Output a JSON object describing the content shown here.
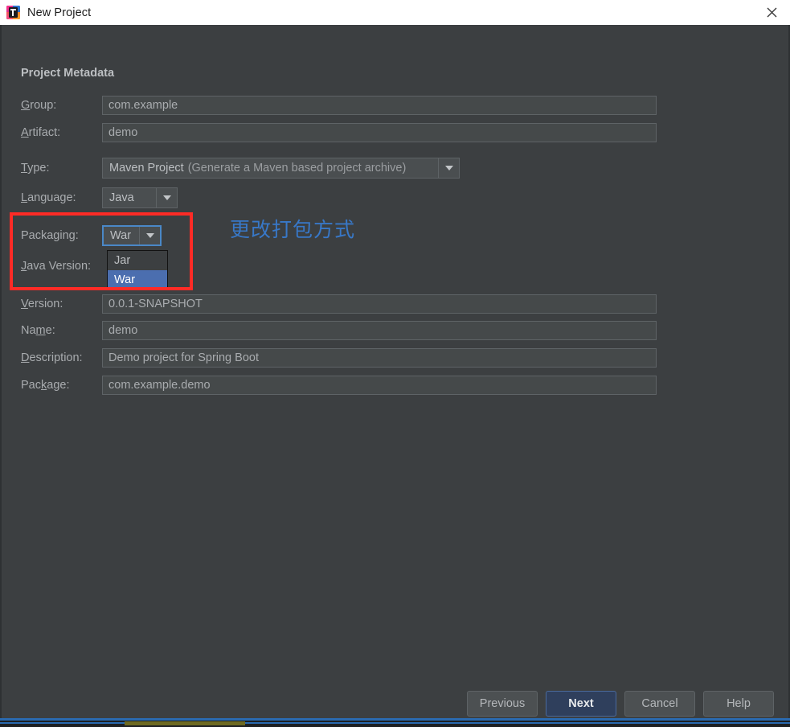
{
  "window": {
    "title": "New Project",
    "app_icon": "intellij-idea-icon",
    "close_icon": "close-icon"
  },
  "form": {
    "section_title": "Project Metadata",
    "fields": [
      {
        "label": "Group:",
        "mnemonic": "G",
        "value": "com.example",
        "type": "text"
      },
      {
        "label": "Artifact:",
        "mnemonic": "A",
        "value": "demo",
        "type": "text"
      },
      {
        "label": "Version:",
        "mnemonic": "V",
        "value": "0.0.1-SNAPSHOT",
        "type": "text"
      },
      {
        "label": "Name:",
        "mnemonic": "m",
        "value": "demo",
        "type": "text"
      },
      {
        "label": "Description:",
        "mnemonic": "D",
        "value": "Demo project for Spring Boot",
        "type": "text"
      },
      {
        "label": "Package:",
        "mnemonic": "k",
        "value": "com.example.demo",
        "type": "text"
      }
    ],
    "type_row": {
      "label": "Type:",
      "mnemonic": "T",
      "value_main": "Maven Project",
      "value_hint": "(Generate a Maven based project archive)",
      "arrow_icon": "chevron-down-icon"
    },
    "language_row": {
      "label": "Language:",
      "mnemonic": "L",
      "value": "Java",
      "arrow_icon": "chevron-down-icon"
    },
    "packaging_row": {
      "label": "Packaging:",
      "mnemonic": "",
      "value": "War",
      "arrow_icon": "chevron-down-icon",
      "options": [
        "Jar",
        "War"
      ],
      "selected": "War",
      "expanded": true
    },
    "java_version_row": {
      "label": "Java Version:",
      "mnemonic": "J"
    }
  },
  "annotation": {
    "text": "更改打包方式",
    "box_color": "#fe2b26",
    "text_color": "#3878c8"
  },
  "buttons": [
    {
      "label": "Previous",
      "default": false
    },
    {
      "label": "Next",
      "default": true
    },
    {
      "label": "Cancel",
      "default": false
    },
    {
      "label": "Help",
      "default": false
    }
  ],
  "colors": {
    "dialog_bg": "#3c3f41",
    "field_bg": "#45494a",
    "accent_blue": "#4b6eaf",
    "focus_blue": "#4a88c7",
    "bottom_accent": "#2a6ab0"
  }
}
